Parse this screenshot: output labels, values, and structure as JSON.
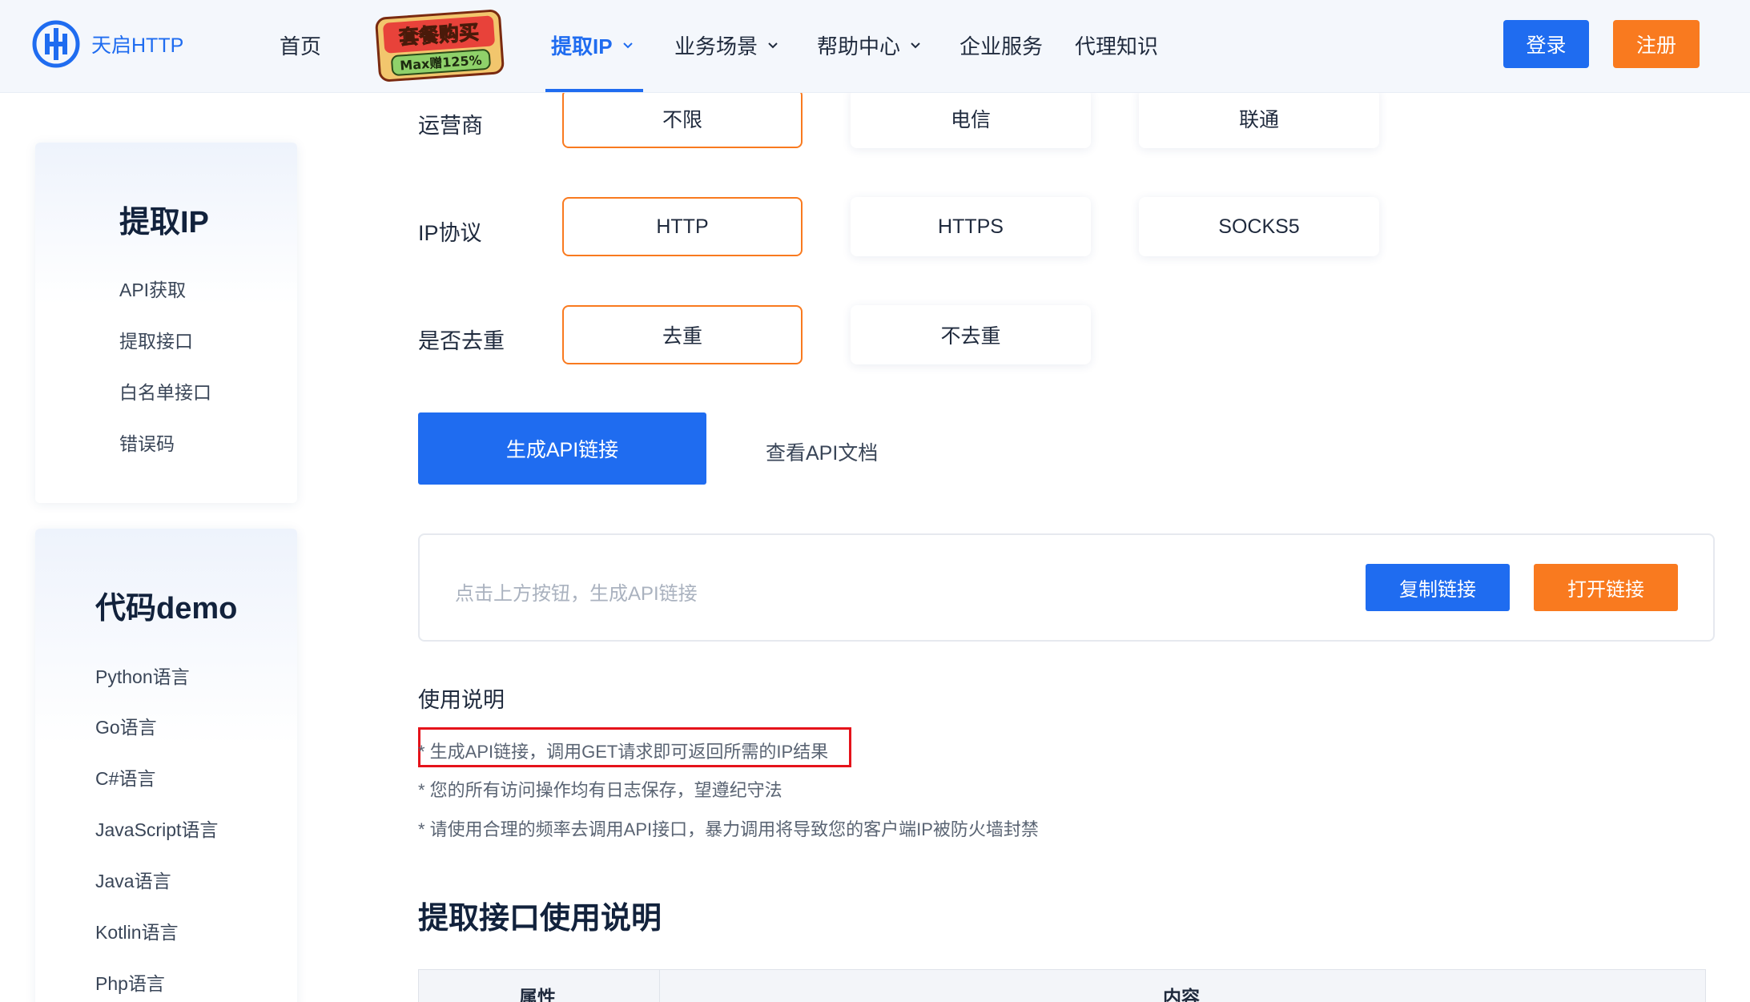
{
  "header": {
    "logo_text": "天启HTTP",
    "nav": {
      "home": "首页",
      "extract_ip": "提取IP",
      "scenarios": "业务场景",
      "help": "帮助中心",
      "enterprise": "企业服务",
      "knowledge": "代理知识"
    },
    "promo": {
      "line1": "套餐购买",
      "line2": "Max赠125%"
    },
    "login": "登录",
    "register": "注册"
  },
  "sidebar": {
    "card1": {
      "title": "提取IP",
      "items": [
        "API获取",
        "提取接口",
        "白名单接口",
        "错误码"
      ]
    },
    "card2": {
      "title": "代码demo",
      "items": [
        "Python语言",
        "Go语言",
        "C#语言",
        "JavaScript语言",
        "Java语言",
        "Kotlin语言",
        "Php语言"
      ]
    }
  },
  "form": {
    "carrier": {
      "label": "运营商",
      "options": [
        "不限",
        "电信",
        "联通"
      ],
      "selected": "不限"
    },
    "protocol": {
      "label": "IP协议",
      "options": [
        "HTTP",
        "HTTPS",
        "SOCKS5"
      ],
      "selected": "HTTP"
    },
    "dedupe": {
      "label": "是否去重",
      "options": [
        "去重",
        "不去重"
      ],
      "selected": "去重"
    },
    "generate_button": "生成API链接",
    "doc_link": "查看API文档",
    "result_placeholder": "点击上方按钮，生成API链接",
    "copy_button": "复制链接",
    "open_button": "打开链接"
  },
  "usage": {
    "title": "使用说明",
    "notes": [
      "* 生成API链接，调用GET请求即可返回所需的IP结果",
      "* 您的所有访问操作均有日志保存，望遵纪守法",
      "* 请使用合理的频率去调用API接口，暴力调用将导致您的客户端IP被防火墙封禁"
    ]
  },
  "extract_api": {
    "title": "提取接口使用说明",
    "table_headers": [
      "属性",
      "内容"
    ]
  },
  "colors": {
    "primary": "#1f6cf0",
    "accent": "#f97a1f",
    "highlight_border": "#e5131b"
  }
}
